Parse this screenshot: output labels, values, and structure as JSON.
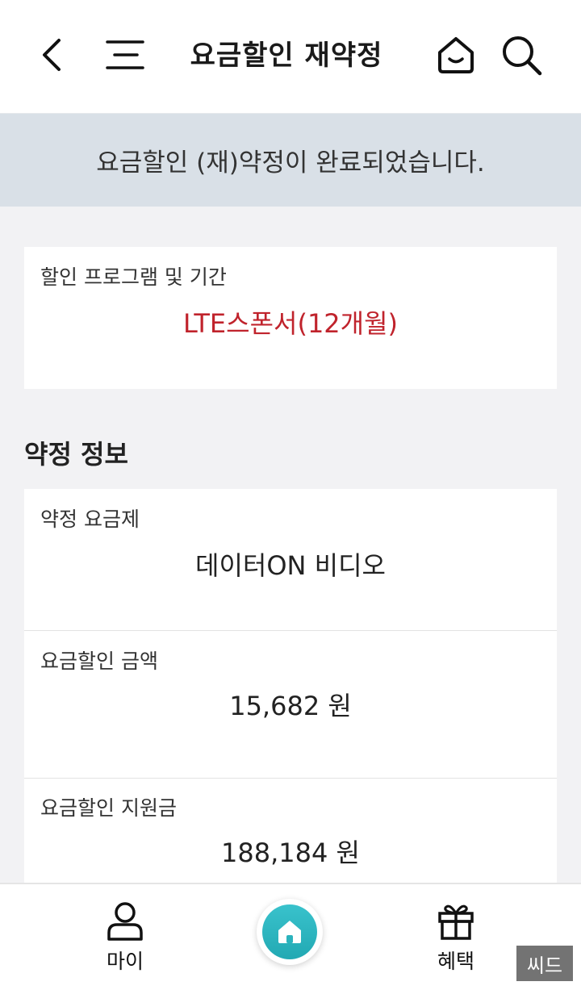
{
  "header": {
    "title": "요금할인 재약정",
    "icons": [
      "back-arrow-icon",
      "menu-icon",
      "home-face-icon",
      "search-icon"
    ]
  },
  "banner": {
    "message": "요금할인 (재)약정이 완료되었습니다."
  },
  "program": {
    "label": "할인 프로그램 및 기간",
    "value": "LTE스폰서(12개월)"
  },
  "contract": {
    "section_title": "약정 정보",
    "items": [
      {
        "label": "약정 요금제",
        "value": "데이터ON 비디오"
      },
      {
        "label": "요금할인 금액",
        "value": "15,682 원"
      },
      {
        "label": "요금할인 지원금",
        "value": "188,184 원"
      }
    ]
  },
  "bottom_nav": {
    "my_label": "마이",
    "benefit_label": "혜택",
    "accent_color": "#2bb3bd"
  },
  "watermark": "씨드",
  "colors": {
    "banner_bg": "#d9e0e7",
    "program_value": "#c0232c",
    "page_bg": "#f2f2f4"
  }
}
